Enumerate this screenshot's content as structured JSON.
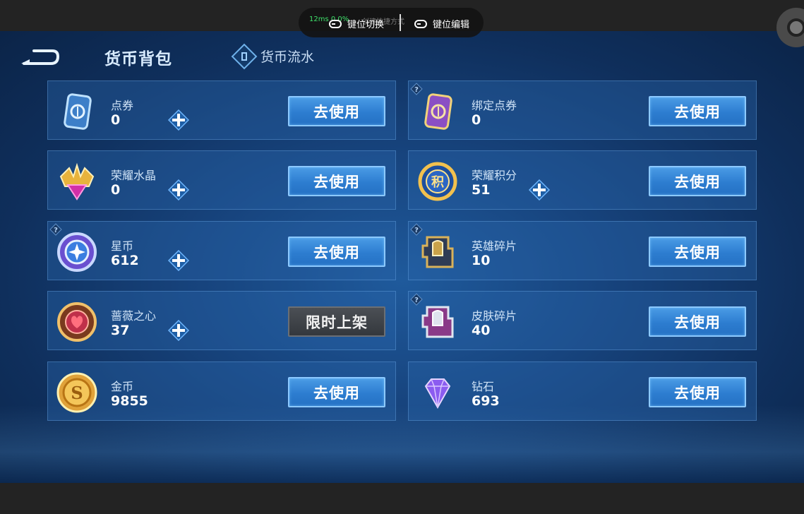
{
  "overlay": {
    "ping": "12ms  0.0%",
    "ghost_text": "创建快捷方式",
    "switch_label": "键位切换",
    "edit_label": "键位编辑"
  },
  "header": {
    "title": "货币背包",
    "flow_label": "货币流水"
  },
  "cards": [
    {
      "name": "点券",
      "value": "0",
      "button": "去使用",
      "icon": "coupon-icon",
      "has_plus": true,
      "has_help": false
    },
    {
      "name": "绑定点券",
      "value": "0",
      "button": "去使用",
      "icon": "bound-coupon-icon",
      "has_plus": false,
      "has_help": true
    },
    {
      "name": "荣耀水晶",
      "value": "0",
      "button": "去使用",
      "icon": "glory-crystal-icon",
      "has_plus": true,
      "has_help": false
    },
    {
      "name": "荣耀积分",
      "value": "51",
      "button": "去使用",
      "icon": "glory-points-icon",
      "has_plus": true,
      "has_help": false
    },
    {
      "name": "星币",
      "value": "612",
      "button": "去使用",
      "icon": "star-coin-icon",
      "has_plus": true,
      "has_help": true
    },
    {
      "name": "英雄碎片",
      "value": "10",
      "button": "去使用",
      "icon": "hero-fragment-icon",
      "has_plus": false,
      "has_help": true
    },
    {
      "name": "蔷薇之心",
      "value": "37",
      "button": "限时上架",
      "icon": "rose-heart-icon",
      "has_plus": true,
      "has_help": false
    },
    {
      "name": "皮肤碎片",
      "value": "40",
      "button": "去使用",
      "icon": "skin-fragment-icon",
      "has_plus": false,
      "has_help": true
    },
    {
      "name": "金币",
      "value": "9855",
      "button": "去使用",
      "icon": "gold-coin-icon",
      "has_plus": false,
      "has_help": false
    },
    {
      "name": "钻石",
      "value": "693",
      "button": "去使用",
      "icon": "diamond-icon",
      "has_plus": false,
      "has_help": false
    }
  ],
  "colors": {
    "button_blue": "#2d7dd0",
    "button_dark": "#34383d",
    "background": "#17447e",
    "ping_green": "#3ee06a"
  }
}
